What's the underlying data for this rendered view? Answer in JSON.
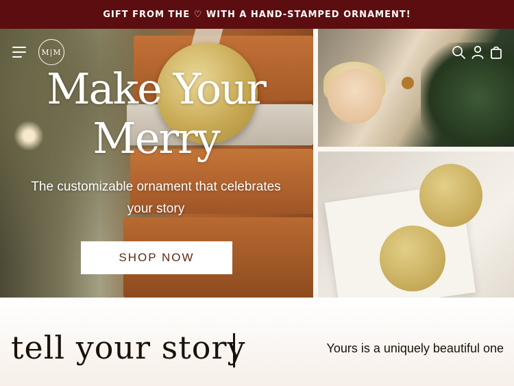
{
  "promo_bar": {
    "text": "GIFT FROM THE ♡ WITH A HAND-STAMPED ORNAMENT!"
  },
  "header": {
    "logo_text": "M|M",
    "icons": [
      "menu-icon",
      "search-icon",
      "account-icon",
      "cart-icon"
    ]
  },
  "hero": {
    "title_line1": "Make Your",
    "title_line2": "Merry",
    "subtitle_line1": "The customizable ornament that celebrates",
    "subtitle_line2": "your story",
    "cta_label": "SHOP NOW"
  },
  "story": {
    "title": "tell your story",
    "tagline": "Yours is a uniquely beautiful one"
  },
  "colors": {
    "promo_bg": "#5c0d0f",
    "cta_text": "#5c2a12",
    "text_dark": "#1a1208"
  }
}
